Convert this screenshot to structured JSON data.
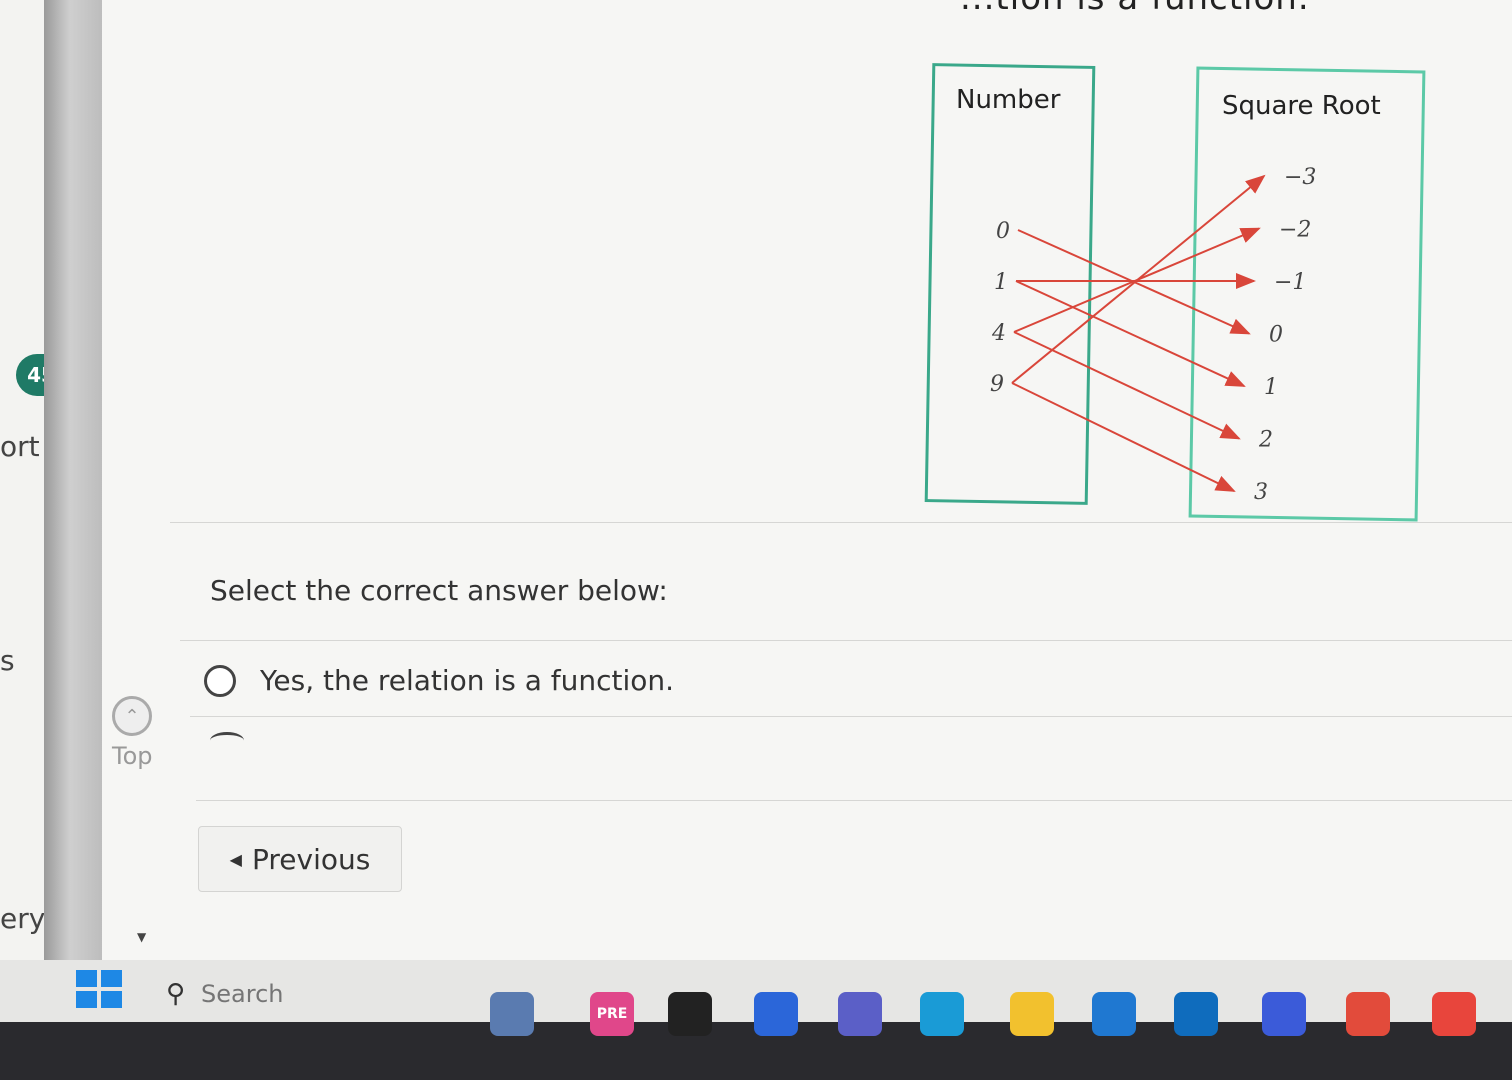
{
  "sidebar": {
    "badge": "45",
    "items": [
      "ort",
      "s",
      "ery"
    ]
  },
  "header": {
    "title_fragment": "...tion is a function."
  },
  "diagram": {
    "left_title": "Number",
    "right_title": "Square Root",
    "left_values": [
      "0",
      "1",
      "4",
      "9"
    ],
    "right_values": [
      "−3",
      "−2",
      "−1",
      "0",
      "1",
      "2",
      "3"
    ],
    "mappings": [
      {
        "from": "0",
        "to": "0"
      },
      {
        "from": "1",
        "to": "−1"
      },
      {
        "from": "1",
        "to": "1"
      },
      {
        "from": "4",
        "to": "−2"
      },
      {
        "from": "4",
        "to": "2"
      },
      {
        "from": "9",
        "to": "−3"
      },
      {
        "from": "9",
        "to": "3"
      }
    ],
    "colors": {
      "box_border": "#3aa88a",
      "arrow": "#d9463a"
    }
  },
  "question": {
    "prompt": "Select the correct answer below:",
    "options": [
      "Yes, the relation is a function."
    ]
  },
  "nav": {
    "previous_label": "Previous",
    "top_label": "Top"
  },
  "taskbar": {
    "search_placeholder": "Search",
    "apps": [
      {
        "name": "widgets-icon",
        "color": "#5a7bb0"
      },
      {
        "name": "copilot-icon",
        "color": "#e0478a",
        "text": "PRE"
      },
      {
        "name": "terminal-icon",
        "color": "#222222"
      },
      {
        "name": "m365-icon",
        "color": "#2b66d9"
      },
      {
        "name": "teams-icon",
        "color": "#5b5fc7"
      },
      {
        "name": "edge-icon",
        "color": "#1a9bd6"
      },
      {
        "name": "file-explorer-icon",
        "color": "#f2c12e"
      },
      {
        "name": "mail-icon",
        "color": "#1f78d1"
      },
      {
        "name": "outlook-icon",
        "color": "#0f6cbd"
      },
      {
        "name": "app-g-icon",
        "color": "#3b5bd9"
      },
      {
        "name": "app-red-icon",
        "color": "#e24b3b"
      },
      {
        "name": "chrome-icon",
        "color": "#e8453c"
      }
    ]
  }
}
